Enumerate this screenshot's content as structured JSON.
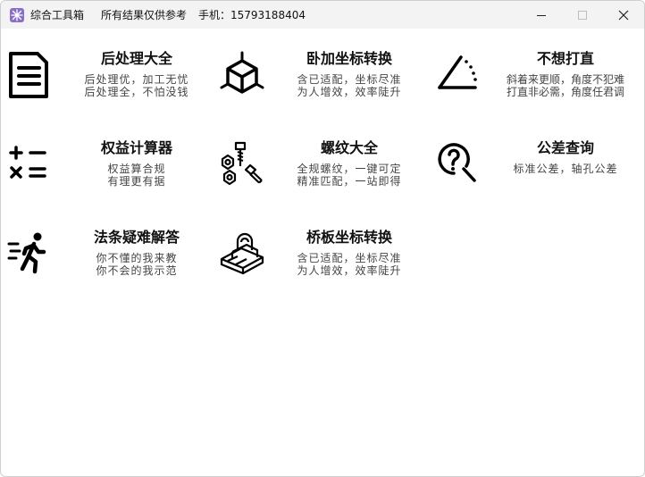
{
  "window": {
    "title": "综合工具箱",
    "disclaimer": "所有结果仅供参考",
    "phone": "手机：15793188404"
  },
  "tools": [
    {
      "name": "后处理大全",
      "icon": "document-icon",
      "desc": [
        "后处理优，加工无忧",
        "后处理全，不怕没钱"
      ]
    },
    {
      "name": "卧加坐标转换",
      "icon": "cube-axes-icon",
      "desc": [
        "含已适配，坐标尽准",
        "为人增效，效率陡升"
      ]
    },
    {
      "name": "不想打直",
      "icon": "angle-icon",
      "desc": [
        "斜着来更顺，角度不犯难",
        "打直非必需，角度任君调"
      ]
    },
    {
      "name": "权益计算器",
      "icon": "calculator-icon",
      "desc": [
        "权益算合规",
        "有理更有据"
      ]
    },
    {
      "name": "螺纹大全",
      "icon": "bolts-nuts-icon",
      "desc": [
        "全规螺纹，一键可定",
        "精准匹配，一站即得"
      ]
    },
    {
      "name": "公差查询",
      "icon": "question-search-icon",
      "desc": [
        "标准公差，轴孔公差"
      ]
    },
    {
      "name": "法条疑难解答",
      "icon": "running-person-icon",
      "desc": [
        "你不懂的我来教",
        "你不会的我示范"
      ]
    },
    {
      "name": "桥板坐标转换",
      "icon": "bridge-plate-icon",
      "desc": [
        "含已适配，坐标尽准",
        "为人增效，效率陡升"
      ]
    }
  ]
}
